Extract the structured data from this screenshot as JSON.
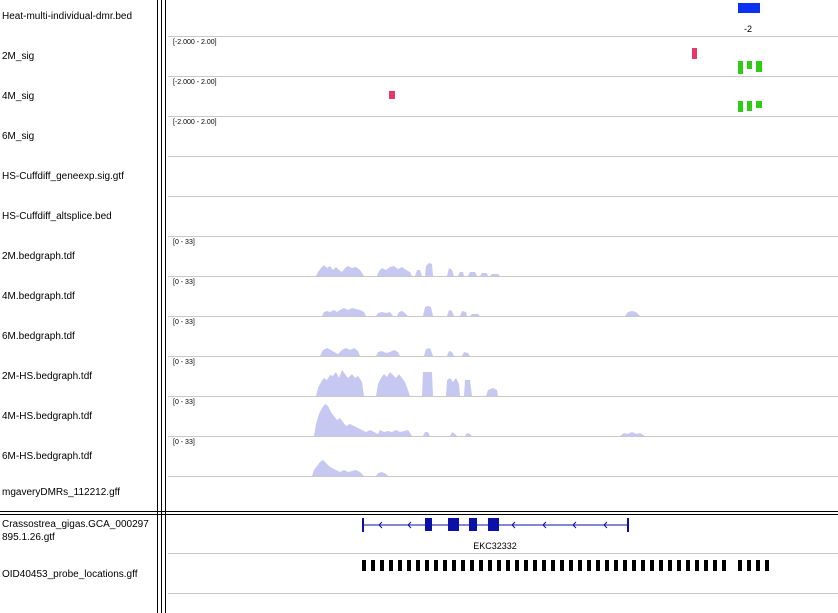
{
  "panels": {
    "data_tracks": [
      {
        "name": "Heat-multi-individual-dmr.bed",
        "range": ""
      },
      {
        "name": "2M_sig",
        "range": "[-2.000 - 2.00]"
      },
      {
        "name": "4M_sig",
        "range": "[-2.000 - 2.00]"
      },
      {
        "name": "6M_sig",
        "range": "[-2.000 - 2.00]"
      },
      {
        "name": "HS-Cuffdiff_geneexp.sig.gtf",
        "range": ""
      },
      {
        "name": "HS-Cuffdiff_altsplice.bed",
        "range": ""
      },
      {
        "name": "2M.bedgraph.tdf",
        "range": "[0 - 33]"
      },
      {
        "name": "4M.bedgraph.tdf",
        "range": "[0 - 33]"
      },
      {
        "name": "6M.bedgraph.tdf",
        "range": "[0 - 33]"
      },
      {
        "name": "2M-HS.bedgraph.tdf",
        "range": "[0 - 33]"
      },
      {
        "name": "4M-HS.bedgraph.tdf",
        "range": "[0 - 33]"
      },
      {
        "name": "6M-HS.bedgraph.tdf",
        "range": "[0 - 33]"
      },
      {
        "name": "mgaveryDMRs_112212.gff",
        "range": ""
      }
    ],
    "feature_tracks": [
      {
        "name": "Crassostrea_gigas.GCA_000297895.1.26.gtf"
      },
      {
        "name": "OID40453_probe_locations.gff"
      }
    ]
  },
  "annotations": {
    "dmr_label": "-2",
    "gene_label": "EKC32332"
  },
  "colors": {
    "dmr_block": "#0a32f0",
    "sig_positive": "#e8386a",
    "sig_negative": "#2ecc14",
    "coverage": "#c6c8f2",
    "gene": "#0a10a8",
    "probe": "#000000"
  }
}
